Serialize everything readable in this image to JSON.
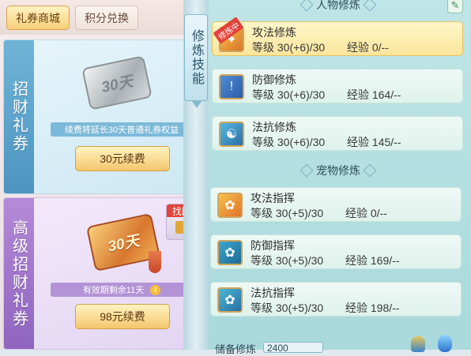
{
  "tabs": {
    "active": "礼券商城",
    "inactive": "积分兑换"
  },
  "card1": {
    "band": "招财礼券",
    "coupon_text": "30天",
    "note": "续费将延长30天普通礼券权益",
    "button": "30元续费"
  },
  "card2": {
    "band": "高级招财礼券",
    "coupon_text": "30天",
    "note": "有效期剩余11天",
    "button": "98元续费",
    "retrieve_label": "找回"
  },
  "cultivate_tab": "修炼技能",
  "sections": {
    "character": "人物修炼",
    "pet": "宠物修炼"
  },
  "skills": [
    {
      "name": "攻法修炼",
      "level_label": "等级",
      "level": "30(+6)/30",
      "exp_label": "经验",
      "exp": "0/--",
      "badge": "修炼中",
      "icon": "attack-icon"
    },
    {
      "name": "防御修炼",
      "level_label": "等级",
      "level": "30(+6)/30",
      "exp_label": "经验",
      "exp": "164/--",
      "icon": "shield-icon"
    },
    {
      "name": "法抗修炼",
      "level_label": "等级",
      "level": "30(+6)/30",
      "exp_label": "经验",
      "exp": "145/--",
      "icon": "taiji-icon"
    },
    {
      "name": "攻法指挥",
      "level_label": "等级",
      "level": "30(+5)/30",
      "exp_label": "经验",
      "exp": "0/--",
      "icon": "paw-attack-icon"
    },
    {
      "name": "防御指挥",
      "level_label": "等级",
      "level": "30(+5)/30",
      "exp_label": "经验",
      "exp": "169/--",
      "icon": "paw-defense-icon"
    },
    {
      "name": "法抗指挥",
      "level_label": "等级",
      "level": "30(+5)/30",
      "exp_label": "经验",
      "exp": "198/--",
      "icon": "paw-resist-icon"
    }
  ],
  "reserve": {
    "label": "储备修炼",
    "value": "2400"
  }
}
